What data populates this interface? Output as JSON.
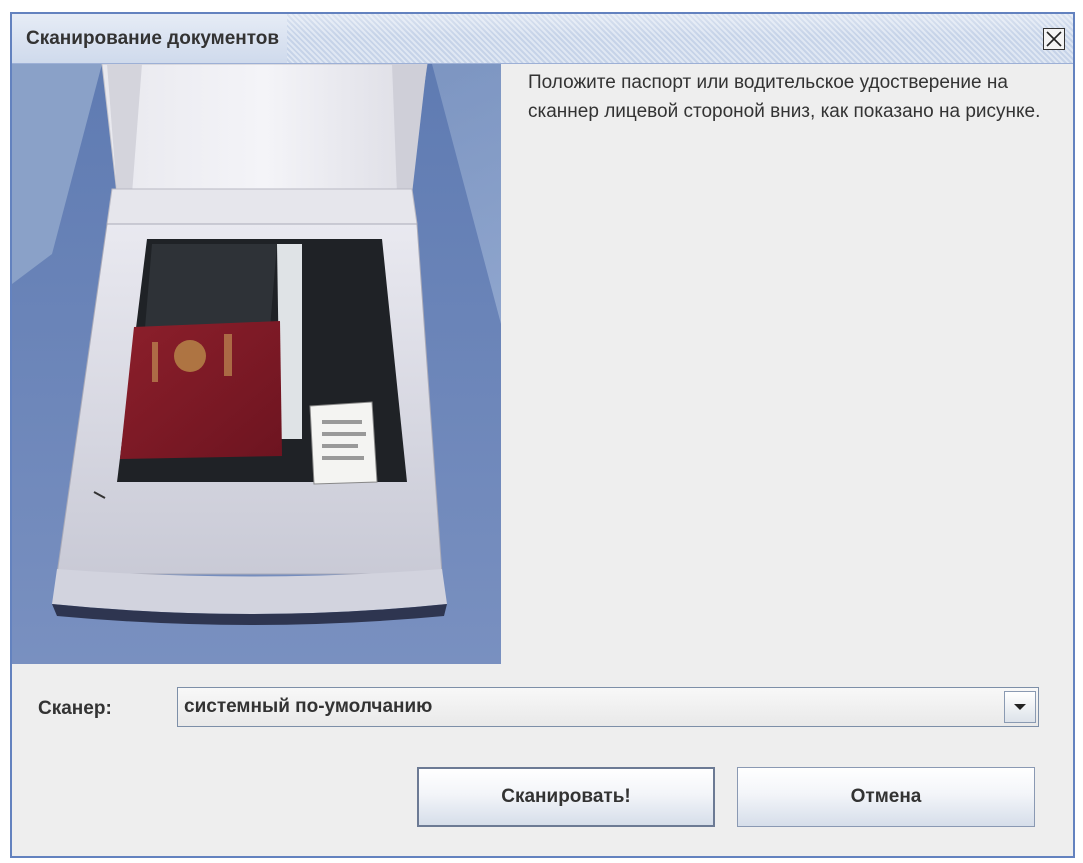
{
  "window": {
    "title": "Сканирование документов",
    "close_icon": "close-icon"
  },
  "instruction": {
    "text": "Положите паспорт или водительское удостверение на сканнер лицевой стороной вниз, как показано на рисунке."
  },
  "illustration": {
    "icon": "scanner-with-passport-photo"
  },
  "scanner": {
    "label": "Сканер:",
    "selected": "системный по-умолчанию",
    "dropdown_icon": "chevron-down-icon"
  },
  "buttons": {
    "scan_label": "Сканировать!",
    "cancel_label": "Отмена"
  },
  "colors": {
    "window_border": "#6382bf",
    "background": "#eeeeee",
    "text": "#333333"
  }
}
